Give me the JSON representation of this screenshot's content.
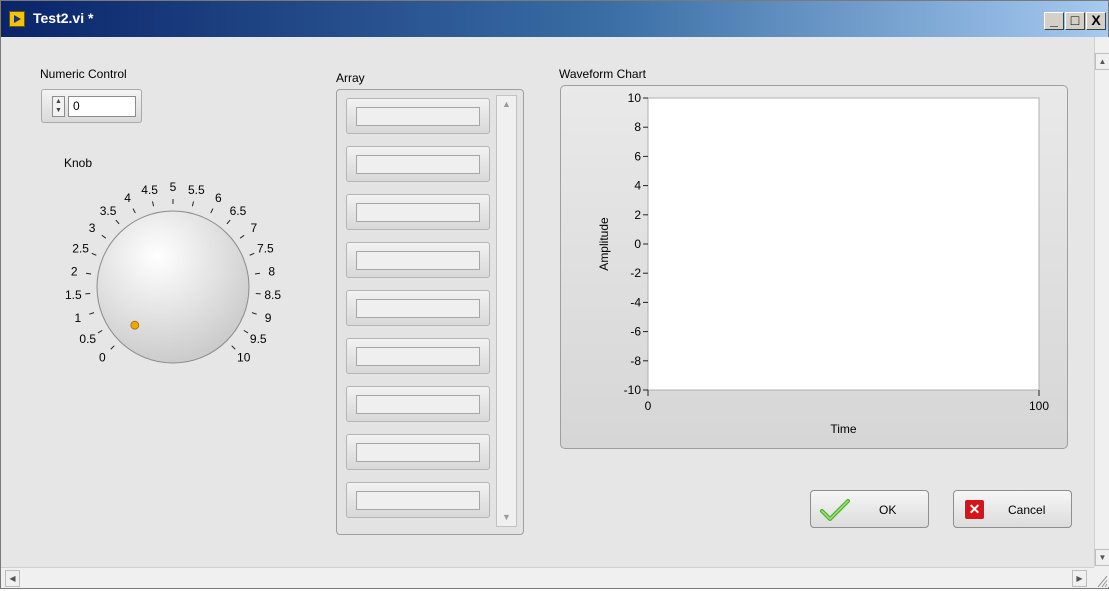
{
  "window": {
    "title": "Test2.vi *",
    "minimize": "_",
    "maximize": "□",
    "close": "X"
  },
  "numeric": {
    "label": "Numeric Control",
    "value": "0"
  },
  "knob": {
    "label": "Knob",
    "min": 0,
    "max": 10,
    "value": 0,
    "ticks": [
      "0",
      "0.5",
      "1",
      "1.5",
      "2",
      "2.5",
      "3",
      "3.5",
      "4",
      "4.5",
      "5",
      "5.5",
      "6",
      "6.5",
      "7",
      "7.5",
      "8",
      "8.5",
      "9",
      "9.5",
      "10"
    ],
    "indicator_color": "#f0a800"
  },
  "array": {
    "label": "Array",
    "visible_elements": 9
  },
  "chart": {
    "label": "Waveform Chart",
    "ylabel": "Amplitude",
    "xlabel": "Time",
    "yticks": [
      "10",
      "8",
      "6",
      "4",
      "2",
      "0",
      "-2",
      "-4",
      "-6",
      "-8",
      "-10"
    ],
    "xticks": [
      "0",
      "100"
    ]
  },
  "chart_data": {
    "type": "line",
    "title": "Waveform Chart",
    "xlabel": "Time",
    "ylabel": "Amplitude",
    "xlim": [
      0,
      100
    ],
    "ylim": [
      -10,
      10
    ],
    "series": []
  },
  "buttons": {
    "ok": "OK",
    "cancel": "Cancel"
  },
  "colors": {
    "title_start": "#0a246a",
    "title_end": "#a6caf0",
    "panel": "#e6e6e6",
    "ok_check": "#4caf30",
    "cancel_red": "#d8141b"
  }
}
